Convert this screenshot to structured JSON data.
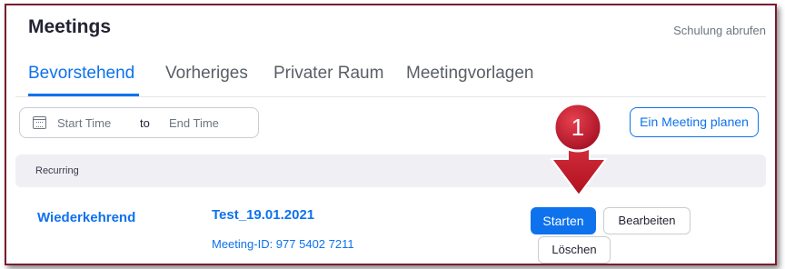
{
  "header": {
    "title": "Meetings",
    "help_link": "Schulung abrufen"
  },
  "tabs": [
    {
      "label": "Bevorstehend",
      "active": true
    },
    {
      "label": "Vorheriges",
      "active": false
    },
    {
      "label": "Privater Raum",
      "active": false
    },
    {
      "label": "Meetingvorlagen",
      "active": false
    }
  ],
  "filter": {
    "start_placeholder": "Start Time",
    "separator": "to",
    "end_placeholder": "End Time"
  },
  "actions": {
    "schedule_label": "Ein Meeting planen"
  },
  "section": {
    "label": "Recurring"
  },
  "meeting": {
    "type": "Wiederkehrend",
    "title": "Test_19.01.2021",
    "meeting_id": "Meeting-ID: 977 5402 7211",
    "start_label": "Starten",
    "edit_label": "Bearbeiten",
    "delete_label": "Löschen"
  },
  "annotation": {
    "step_number": "1",
    "badge_color": "#c8152e",
    "arrow_color": "#c8152e"
  },
  "colors": {
    "accent": "#0e72ed",
    "frame": "#7b1c2e"
  }
}
